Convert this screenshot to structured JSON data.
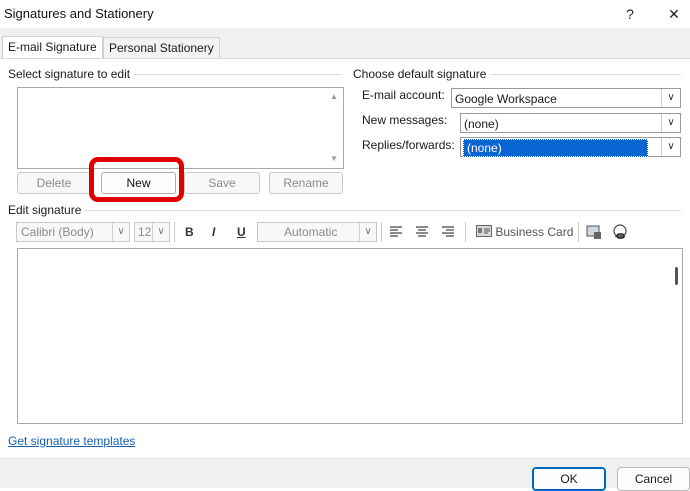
{
  "window": {
    "title": "Signatures and Stationery",
    "help_icon": "?",
    "close_icon": "✕"
  },
  "tabs": [
    {
      "label": "E-mail Signature",
      "active": true
    },
    {
      "label": "Personal Stationery",
      "active": false
    }
  ],
  "select_section": {
    "label": "Select signature to edit",
    "buttons": {
      "delete": "Delete",
      "new": "New",
      "save": "Save",
      "rename": "Rename"
    }
  },
  "default_section": {
    "label": "Choose default signature",
    "email_account_label": "E-mail account:",
    "email_account_value": "Google Workspace",
    "new_messages_label": "New messages:",
    "new_messages_value": "(none)",
    "replies_label": "Replies/forwards:",
    "replies_value": "(none)"
  },
  "edit_section": {
    "label": "Edit signature",
    "font": "Calibri (Body)",
    "size": "12",
    "bold": "B",
    "italic": "I",
    "underline": "U",
    "color": "Automatic",
    "business_card": "Business Card"
  },
  "link": "Get signature templates",
  "footer": {
    "ok": "OK",
    "cancel": "Cancel"
  },
  "colors": {
    "highlight": "#e00000",
    "selection": "#0a64d2",
    "link": "#1a5fb4"
  }
}
